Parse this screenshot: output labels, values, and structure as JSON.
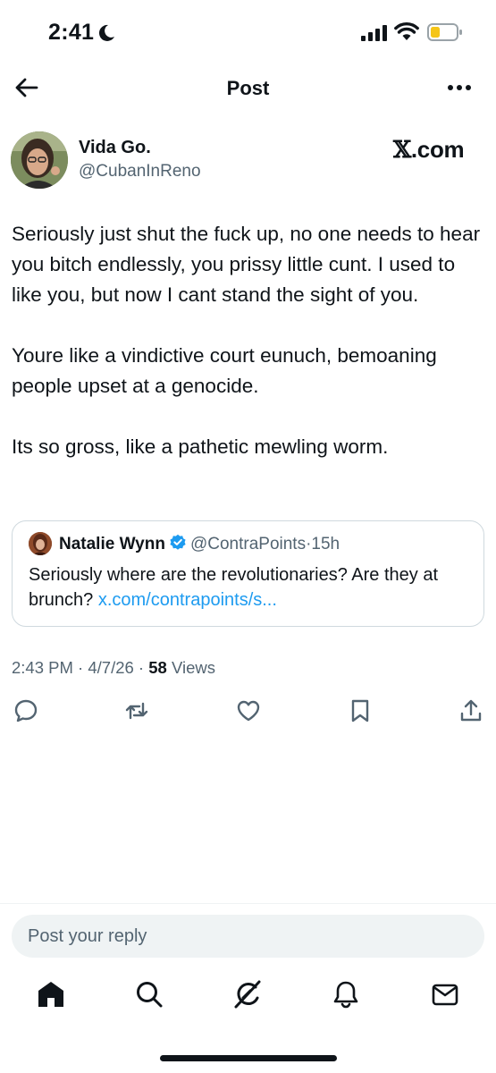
{
  "status_bar": {
    "time": "2:41",
    "icons": [
      "moon-icon",
      "cellular-signal-icon",
      "wifi-icon",
      "battery-low-icon"
    ],
    "battery_color": "#f5c518"
  },
  "header": {
    "title": "Post",
    "back_icon": "arrow-left-icon",
    "more_icon": "more-horizontal-icon"
  },
  "author": {
    "name": "Vida Go.",
    "handle": "@CubanInReno"
  },
  "watermark": {
    "x": "𝕏",
    "domain": ".com"
  },
  "tweet": {
    "paragraphs": [
      "Seriously just shut the fuck up, no one needs to hear you bitch endlessly, you prissy little cunt. I used to like you, but now I cant stand the sight of you.",
      "Youre like a vindictive court eunuch, bemoaning people upset at a genocide.",
      "Its so gross, like a pathetic mewling worm."
    ]
  },
  "quote": {
    "name": "Natalie Wynn",
    "handle": "@ContraPoints",
    "separator": "·",
    "age": "15h",
    "text": "Seriously where are the revolutionaries? Are they at brunch? ",
    "link": "x.com/contrapoints/s..."
  },
  "meta": {
    "time": "2:43 PM",
    "sep1": " · ",
    "date": "4/7/26",
    "sep2": " · ",
    "views_count": "58",
    "views_label": " Views"
  },
  "actions": [
    "reply-icon",
    "repost-icon",
    "like-icon",
    "bookmark-icon",
    "share-icon"
  ],
  "reply": {
    "placeholder": "Post your reply"
  },
  "nav": [
    "home-icon",
    "search-icon",
    "grok-icon",
    "notifications-icon",
    "messages-icon"
  ],
  "colors": {
    "text": "#0f1419",
    "secondary": "#536471",
    "link": "#1d9bf0",
    "border": "#cfd9de",
    "input_bg": "#eff3f4"
  }
}
